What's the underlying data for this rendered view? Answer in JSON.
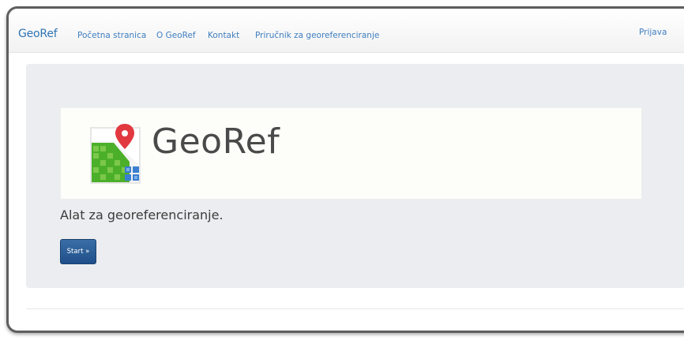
{
  "navbar": {
    "brand": "GeoRef",
    "links": [
      {
        "label": "Početna stranica"
      },
      {
        "label": "O GeoRef"
      },
      {
        "label": "Kontakt"
      },
      {
        "label": "Priručnik za georeferenciranje"
      }
    ],
    "login": "Prijava"
  },
  "hero": {
    "logo_title": "GeoRef",
    "logo_icon": "map-pin-grid-icon",
    "tagline": "Alat za georeferenciranje.",
    "start_button": "Start »"
  },
  "colors": {
    "link": "#3f7ec0",
    "button": "#2a5d96",
    "jumbotron_bg": "#ebedf0",
    "pin": "#e2383f"
  }
}
